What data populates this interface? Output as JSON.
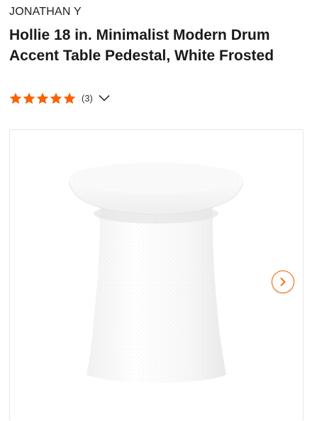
{
  "product": {
    "brand": "JONATHAN Y",
    "title": "Hollie 18 in. Minimalist Modern Drum Accent Table Pedestal, White Frosted",
    "rating": {
      "stars": 5,
      "count_label": "(3)"
    }
  },
  "gallery": {
    "image_icon": "pedestal-table-image",
    "next_icon": "chevron-right-icon"
  },
  "colors": {
    "accent": "#f96302",
    "text": "#1f1f1f"
  }
}
